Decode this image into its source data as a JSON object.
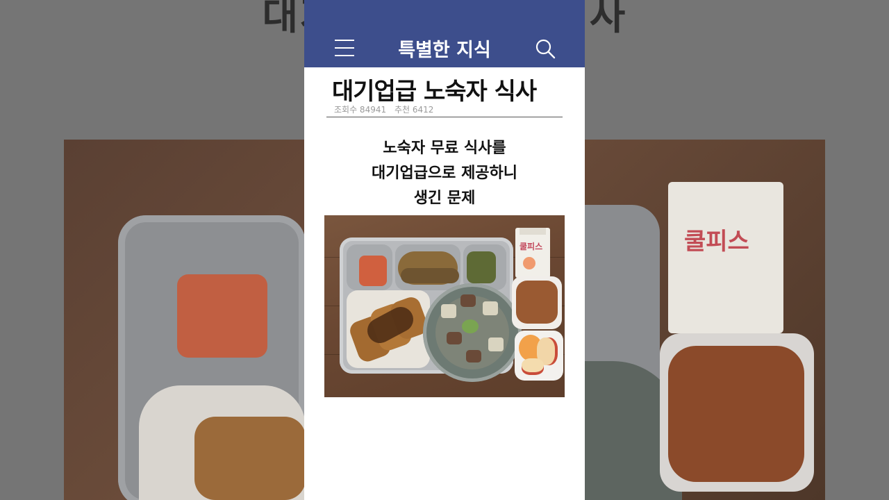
{
  "backdrop": {
    "title": "대기업급 노숙자 식사",
    "milk_label": "쿨피스"
  },
  "app": {
    "title": "특별한 지식",
    "menu_icon": "hamburger-menu-icon",
    "search_icon": "search-icon",
    "bar_color": "#3d4e8c"
  },
  "post": {
    "headline": "대기업급 노숙자 식사",
    "views_label": "조회수 84941",
    "recommend_label": "추천 6412",
    "subtitle_lines": [
      "노숙자 무료 식사를",
      "대기업급으로 제공하니",
      "생긴 문제"
    ]
  },
  "photo": {
    "milk_label": "쿨피스"
  }
}
